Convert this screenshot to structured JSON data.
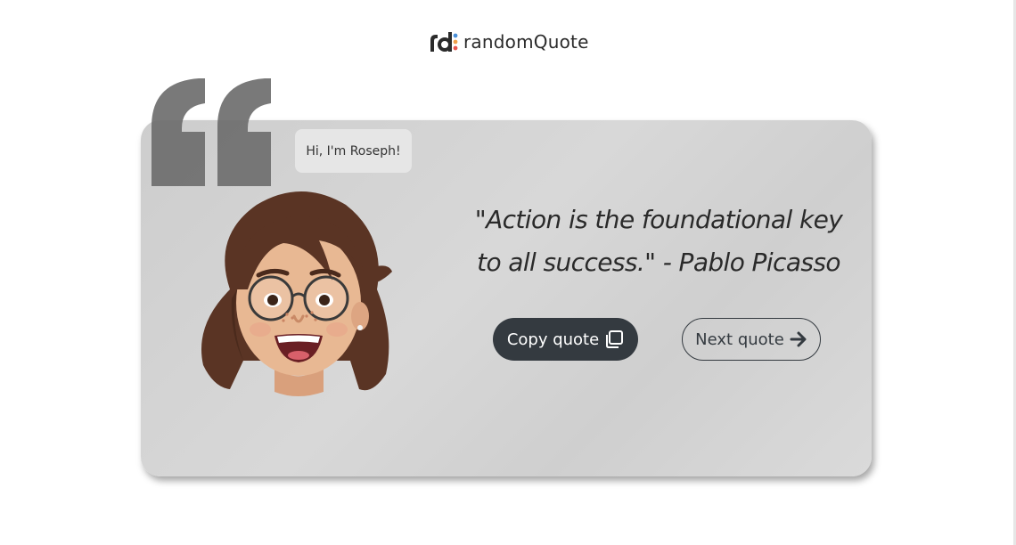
{
  "header": {
    "logo_text": "randomQuote",
    "logo_icon": "rd-logo-icon"
  },
  "card": {
    "speech_bubble": "Hi, I'm Roseph!",
    "quote": "\"Action is the foundational key to all success.\" - Pablo Picasso",
    "copy_button": "Copy quote",
    "next_button": "Next quote",
    "copy_icon": "copy-icon",
    "next_icon": "arrow-right-icon",
    "decor_icon": "quote-mark-icon"
  },
  "colors": {
    "button_dark": "#343a40",
    "card_bg": "#d4d4d4",
    "quote_mark": "#6e6e6e",
    "logo_blue": "#4a90d9",
    "logo_orange": "#f0a04b",
    "logo_red": "#e8554e"
  }
}
